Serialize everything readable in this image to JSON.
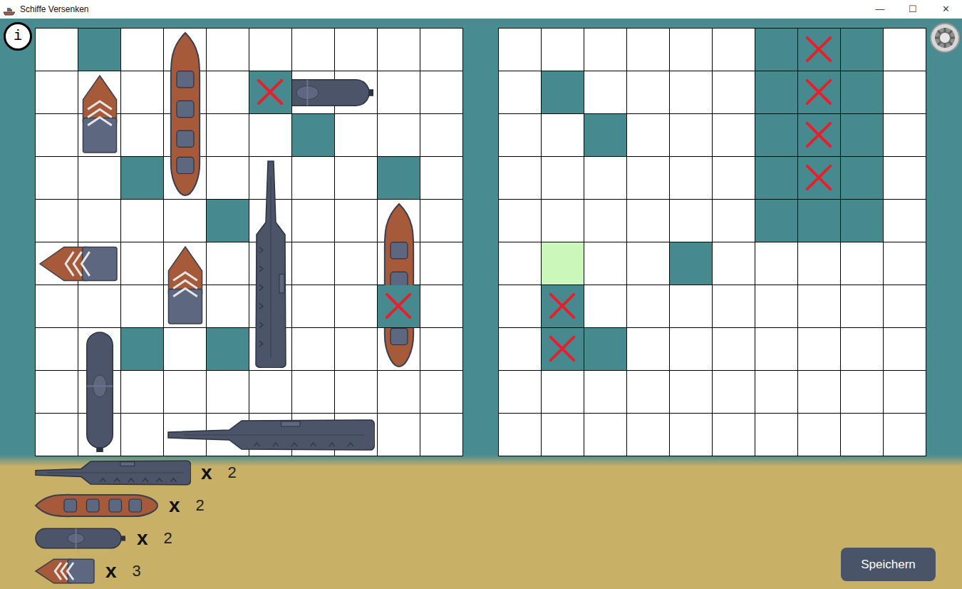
{
  "window": {
    "title": "Schiffe Versenken",
    "controls": [
      "—",
      "☐",
      "✕"
    ]
  },
  "info_button": {
    "label": "i"
  },
  "boards": [
    {
      "cells": [
        [
          "empty",
          "water",
          "empty",
          "empty",
          "empty",
          "empty",
          "empty",
          "empty",
          "empty",
          "empty"
        ],
        [
          "empty",
          "empty",
          "empty",
          "empty",
          "empty",
          "hit",
          "empty",
          "empty",
          "empty",
          "empty"
        ],
        [
          "empty",
          "empty",
          "empty",
          "empty",
          "empty",
          "empty",
          "water",
          "empty",
          "empty",
          "empty"
        ],
        [
          "empty",
          "empty",
          "water",
          "empty",
          "empty",
          "empty",
          "empty",
          "empty",
          "water",
          "empty"
        ],
        [
          "empty",
          "empty",
          "empty",
          "empty",
          "water",
          "empty",
          "empty",
          "empty",
          "empty",
          "empty"
        ],
        [
          "empty",
          "empty",
          "empty",
          "empty",
          "empty",
          "empty",
          "empty",
          "empty",
          "empty",
          "empty"
        ],
        [
          "empty",
          "empty",
          "empty",
          "empty",
          "empty",
          "empty",
          "empty",
          "empty",
          "hit",
          "empty"
        ],
        [
          "empty",
          "empty",
          "water",
          "empty",
          "water",
          "empty",
          "empty",
          "empty",
          "empty",
          "empty"
        ],
        [
          "empty",
          "empty",
          "empty",
          "empty",
          "empty",
          "empty",
          "empty",
          "empty",
          "empty",
          "empty"
        ],
        [
          "empty",
          "empty",
          "empty",
          "empty",
          "empty",
          "empty",
          "empty",
          "empty",
          "empty",
          "empty"
        ]
      ],
      "ships": [
        {
          "kind": "boat",
          "vertical": true,
          "row": 1,
          "col": 1
        },
        {
          "kind": "battleship",
          "vertical": true,
          "row": 0,
          "col": 3
        },
        {
          "kind": "submarine",
          "vertical": false,
          "row": 1,
          "col": 5
        },
        {
          "kind": "carrier",
          "vertical": true,
          "row": 3,
          "col": 5
        },
        {
          "kind": "battleship",
          "vertical": true,
          "row": 4,
          "col": 8
        },
        {
          "kind": "boat",
          "vertical": false,
          "row": 5,
          "col": 0
        },
        {
          "kind": "boat",
          "vertical": true,
          "row": 5,
          "col": 3
        },
        {
          "kind": "submarine",
          "vertical": true,
          "row": 7,
          "col": 1
        },
        {
          "kind": "carrier",
          "vertical": false,
          "row": 9,
          "col": 3
        }
      ]
    },
    {
      "cells": [
        [
          "empty",
          "empty",
          "empty",
          "empty",
          "empty",
          "empty",
          "water",
          "hit",
          "water",
          "empty"
        ],
        [
          "empty",
          "water",
          "empty",
          "empty",
          "empty",
          "empty",
          "water",
          "hit",
          "water",
          "empty"
        ],
        [
          "empty",
          "empty",
          "water",
          "empty",
          "empty",
          "empty",
          "water",
          "hit",
          "water",
          "empty"
        ],
        [
          "empty",
          "empty",
          "empty",
          "empty",
          "empty",
          "empty",
          "water",
          "hit",
          "water",
          "empty"
        ],
        [
          "empty",
          "empty",
          "empty",
          "empty",
          "empty",
          "empty",
          "water",
          "water",
          "water",
          "empty"
        ],
        [
          "empty",
          "target",
          "empty",
          "empty",
          "water",
          "empty",
          "empty",
          "empty",
          "empty",
          "empty"
        ],
        [
          "empty",
          "hit",
          "empty",
          "empty",
          "empty",
          "empty",
          "empty",
          "empty",
          "empty",
          "empty"
        ],
        [
          "empty",
          "hit",
          "water",
          "empty",
          "empty",
          "empty",
          "empty",
          "empty",
          "empty",
          "empty"
        ],
        [
          "empty",
          "empty",
          "empty",
          "empty",
          "empty",
          "empty",
          "empty",
          "empty",
          "empty",
          "empty"
        ],
        [
          "empty",
          "empty",
          "empty",
          "empty",
          "empty",
          "empty",
          "empty",
          "empty",
          "empty",
          "empty"
        ]
      ],
      "ships": []
    }
  ],
  "legend": [
    {
      "kind": "carrier",
      "sign": "x",
      "count": "2"
    },
    {
      "kind": "battleship",
      "sign": "x",
      "count": "2"
    },
    {
      "kind": "submarine",
      "sign": "x",
      "count": "2"
    },
    {
      "kind": "boat",
      "sign": "x",
      "count": "3"
    }
  ],
  "save_button": {
    "label": "Speichern"
  }
}
